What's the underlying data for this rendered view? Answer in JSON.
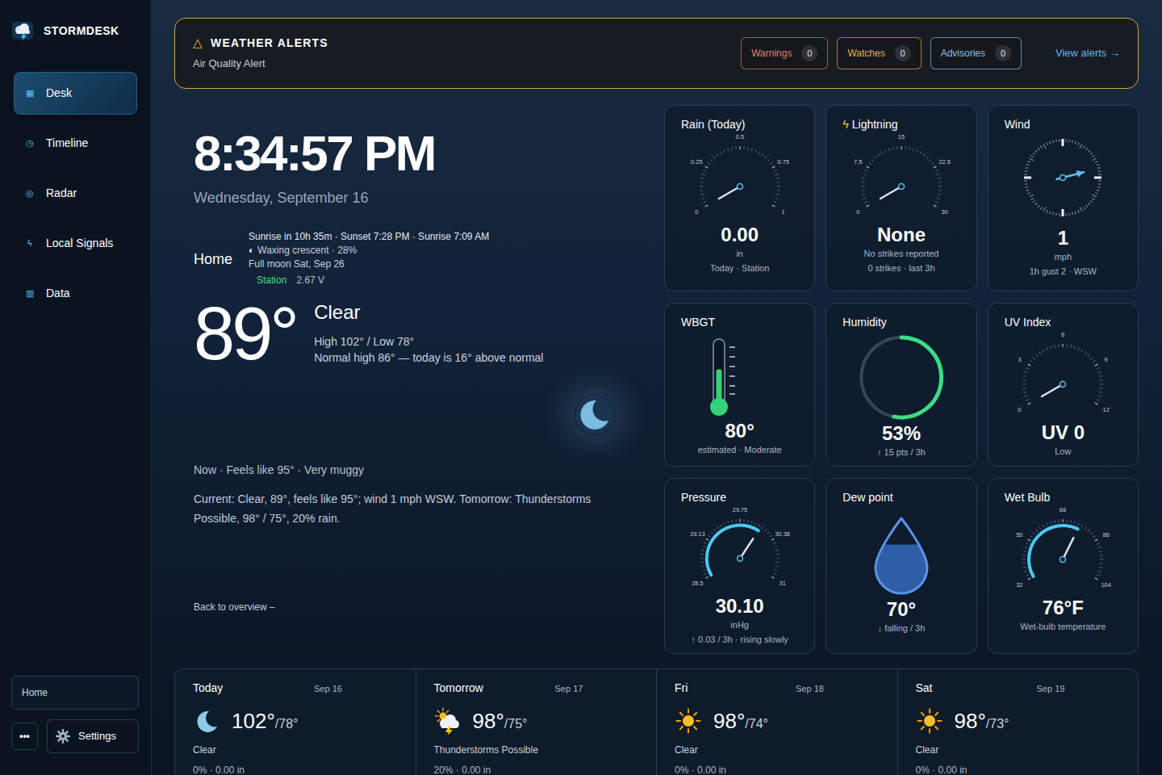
{
  "app": {
    "name": "STORMDESK"
  },
  "sidebar": {
    "items": [
      {
        "icon": "▦",
        "label": "Desk",
        "selected": true
      },
      {
        "icon": "◷",
        "label": "Timeline",
        "selected": false
      },
      {
        "icon": "◎",
        "label": "Radar",
        "selected": false
      },
      {
        "icon": "ϟ",
        "label": "Local Signals",
        "selected": false
      },
      {
        "icon": "▥",
        "label": "Data",
        "selected": false
      }
    ],
    "location": "Home",
    "more": "•••",
    "settings": "Settings"
  },
  "alerts": {
    "icon": "△",
    "title": "WEATHER ALERTS",
    "subtitle": "Air Quality Alert",
    "counts": [
      {
        "label": "Warnings",
        "count": "0",
        "color": "#e0806f"
      },
      {
        "label": "Watches",
        "count": "0",
        "color": "#e6b04f"
      },
      {
        "label": "Advisories",
        "count": "0",
        "color": "#8cc0f0"
      }
    ],
    "link": "View alerts →"
  },
  "hero": {
    "time": "8:34:57 PM",
    "date": "Wednesday, September 16",
    "location": "Home",
    "sun": "Sunrise in 10h 35m · Sunset 7:28 PM · Sunrise 7:09 AM",
    "moon_icon": "◐",
    "moon": "Waxing crescent · 28%",
    "full_moon": "Full moon Sat, Sep 26",
    "station_label": "Station",
    "station_value": "2.67 V",
    "temp": "89°",
    "condition": "Clear",
    "high_low": "High 102° / Low 78°",
    "normal": "Normal high 86° — today is 16° above normal",
    "feels": "Now · Feels like 95° · Very muggy",
    "summary": "Current: Clear, 89°, feels like 95°; wind 1 mph WSW. Tomorrow: Thunderstorms Possible, 98° / 75°, 20% rain.",
    "back": "Back to overview –"
  },
  "tiles": [
    {
      "kind": "gauge",
      "title": "Rain (Today)",
      "ticks": [
        "0",
        "0.25",
        "0.5",
        "0.75",
        "1"
      ],
      "value": "0.00",
      "lines": [
        "in",
        "Today · Station"
      ],
      "level": 0
    },
    {
      "kind": "gauge",
      "icon": "ϟ",
      "title": "Lightning",
      "ticks": [
        "0",
        "7.5",
        "15",
        "22.5",
        "30"
      ],
      "value": "None",
      "lines": [
        "No strikes reported",
        "0 strikes · last 3h"
      ],
      "level": 0
    },
    {
      "kind": "compass",
      "title": "Wind",
      "value": "1",
      "lines": [
        "mph",
        "1h gust 2 · WSW"
      ],
      "level": 0.21
    },
    {
      "kind": "thermo",
      "title": "WBGT",
      "value": "80°",
      "lines": [
        "estimated · Moderate"
      ],
      "level": 0.6
    },
    {
      "kind": "ring",
      "title": "Humidity",
      "value": "53%",
      "lines": [
        "↑ 15 pts / 3h"
      ],
      "level": 0.53
    },
    {
      "kind": "gauge",
      "title": "UV Index",
      "ticks": [
        "0",
        "3",
        "6",
        "9",
        "12"
      ],
      "value": "UV 0",
      "lines": [
        "Low"
      ],
      "level": 0
    },
    {
      "kind": "gauge",
      "title": "Pressure",
      "ticks": [
        "28.5",
        "29.13",
        "29.75",
        "30.38",
        "31"
      ],
      "value": "30.10",
      "lines": [
        "inHg",
        "↑ 0.03 / 3h · rising slowly"
      ],
      "level": 0.64
    },
    {
      "kind": "drop",
      "title": "Dew point",
      "value": "70°",
      "lines": [
        "↓ falling / 3h"
      ],
      "level": 0.65
    },
    {
      "kind": "gauge",
      "title": "Wet Bulb",
      "ticks": [
        "32",
        "50",
        "68",
        "86",
        "104"
      ],
      "value": "76°F",
      "lines": [
        "Wet-bulb temperature"
      ],
      "level": 0.61
    }
  ],
  "forecast": [
    {
      "kind": "moon",
      "day": "Today",
      "date": "Sep 16",
      "high": "102°",
      "low": "/78°",
      "condition": "Clear",
      "precip": "0% · 0.00 in"
    },
    {
      "kind": "storm",
      "day": "Tomorrow",
      "date": "Sep 17",
      "high": "98°",
      "low": "/75°",
      "condition": "Thunderstorms Possible",
      "precip": "20% · 0.00 in"
    },
    {
      "kind": "sun",
      "day": "Fri",
      "date": "Sep 18",
      "high": "98°",
      "low": "/74°",
      "condition": "Clear",
      "precip": "0% · 0.00 in"
    },
    {
      "kind": "sun",
      "day": "Sat",
      "date": "Sep 19",
      "high": "98°",
      "low": "/73°",
      "condition": "Clear",
      "precip": "0% · 0.00 in"
    }
  ]
}
